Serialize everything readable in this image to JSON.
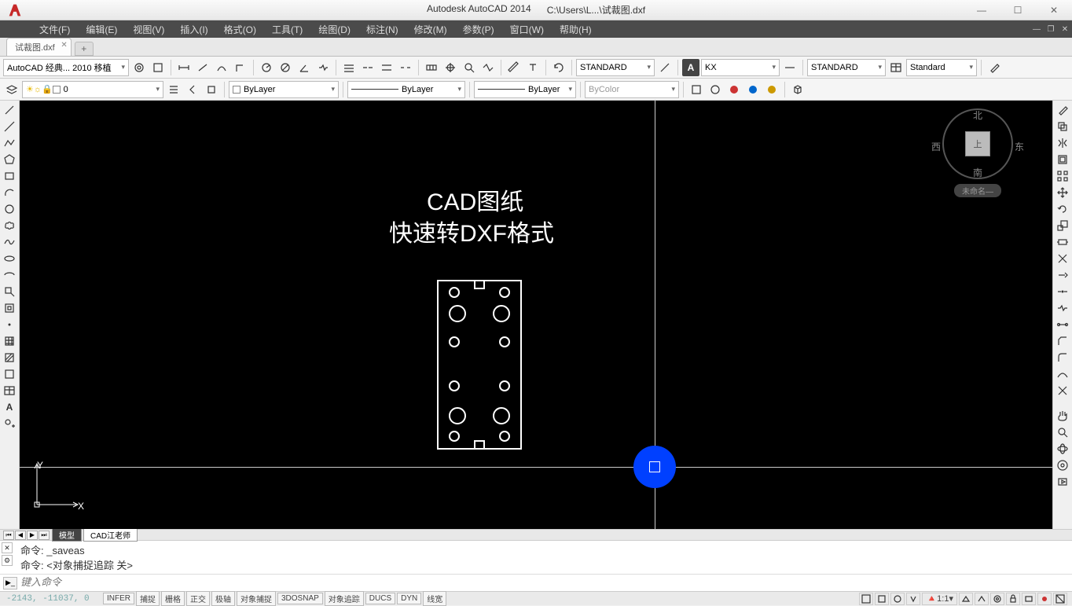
{
  "title": {
    "app": "Autodesk AutoCAD 2014",
    "path": "C:\\Users\\L...\\试裁图.dxf"
  },
  "menu": [
    "文件(F)",
    "编辑(E)",
    "视图(V)",
    "插入(I)",
    "格式(O)",
    "工具(T)",
    "绘图(D)",
    "标注(N)",
    "修改(M)",
    "参数(P)",
    "窗口(W)",
    "帮助(H)"
  ],
  "tab": {
    "name": "试裁图.dxf"
  },
  "workspace": "AutoCAD 经典... 2010 移植",
  "toolbar1": {
    "text_style": "STANDARD",
    "font": "KX",
    "dim_style": "STANDARD",
    "table_style": "Standard"
  },
  "toolbar2": {
    "layer": "0",
    "linetype": "ByLayer",
    "lineweight": "ByLayer",
    "plotstyle": "ByLayer",
    "color": "ByColor"
  },
  "canvas": {
    "txt1": "CAD图纸",
    "txt2": "快速转DXF格式",
    "ucs_y": "Y",
    "ucs_x": "X"
  },
  "viewcube": {
    "n": "北",
    "s": "南",
    "e": "东",
    "w": "西",
    "face": "上",
    "label": "未命名—"
  },
  "modeltabs": {
    "model": "模型",
    "layout1": "CAD江老师"
  },
  "cmd": {
    "l1": "命令:  _saveas",
    "l2": "命令:  <对象捕捉追踪  关>",
    "placeholder": "键入命令"
  },
  "status": {
    "coords": "-2143, -11037,  0",
    "btns": [
      "INFER",
      "捕捉",
      "栅格",
      "正交",
      "极轴",
      "对象捕捉",
      "3DOSNAP",
      "对象追踪",
      "DUCS",
      "DYN",
      "线宽"
    ],
    "scale": "1:1"
  }
}
